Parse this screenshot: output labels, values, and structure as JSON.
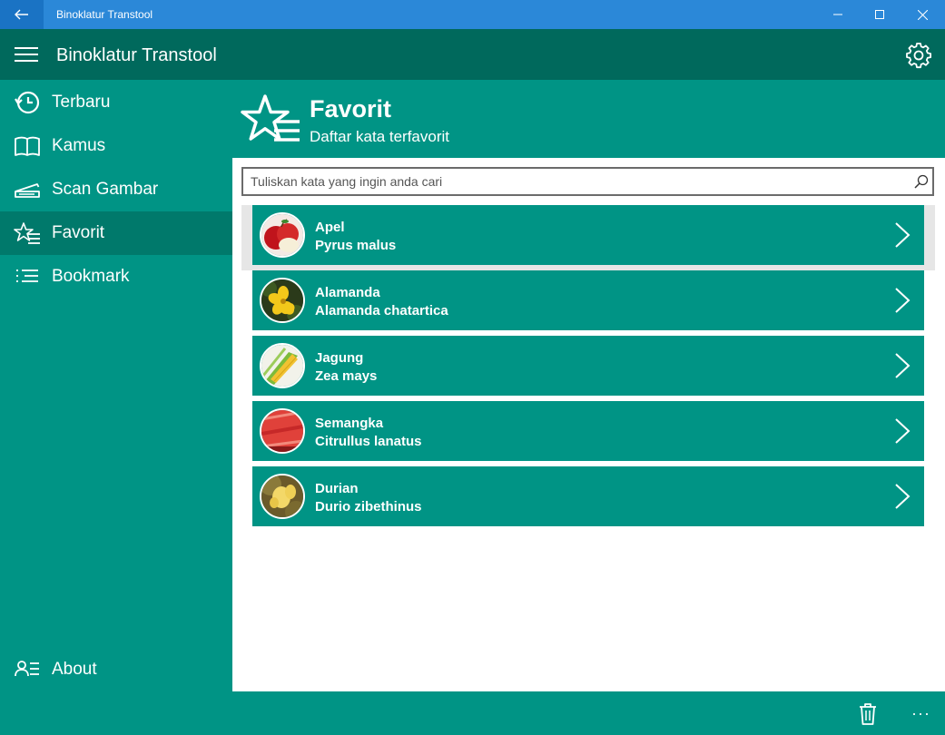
{
  "window": {
    "title": "Binoklatur Transtool"
  },
  "appbar": {
    "title": "Binoklatur Transtool"
  },
  "sidebar": {
    "items": [
      {
        "label": "Terbaru",
        "icon": "history-icon"
      },
      {
        "label": "Kamus",
        "icon": "book-icon"
      },
      {
        "label": "Scan Gambar",
        "icon": "scanner-icon"
      },
      {
        "label": "Favorit",
        "icon": "star-list-icon",
        "active": true
      },
      {
        "label": "Bookmark",
        "icon": "list-icon"
      }
    ],
    "about": {
      "label": "About",
      "icon": "contact-list-icon"
    }
  },
  "page": {
    "title": "Favorit",
    "subtitle": "Daftar kata terfavorit"
  },
  "search": {
    "placeholder": "Tuliskan kata yang ingin anda cari",
    "value": ""
  },
  "items": [
    {
      "title": "Apel",
      "subtitle": "Pyrus malus",
      "thumb": "apple-image"
    },
    {
      "title": "Alamanda",
      "subtitle": "Alamanda chatartica",
      "thumb": "allamanda-flower-image"
    },
    {
      "title": "Jagung",
      "subtitle": "Zea mays",
      "thumb": "corn-image"
    },
    {
      "title": "Semangka",
      "subtitle": "Citrullus lanatus",
      "thumb": "watermelon-image"
    },
    {
      "title": "Durian",
      "subtitle": "Durio zibethinus",
      "thumb": "durian-image"
    }
  ],
  "colors": {
    "primary": "#009485",
    "dark": "#00695c",
    "active": "#00796b",
    "titlebar": "#2b88d8"
  },
  "bottombar": {
    "more": "···"
  }
}
